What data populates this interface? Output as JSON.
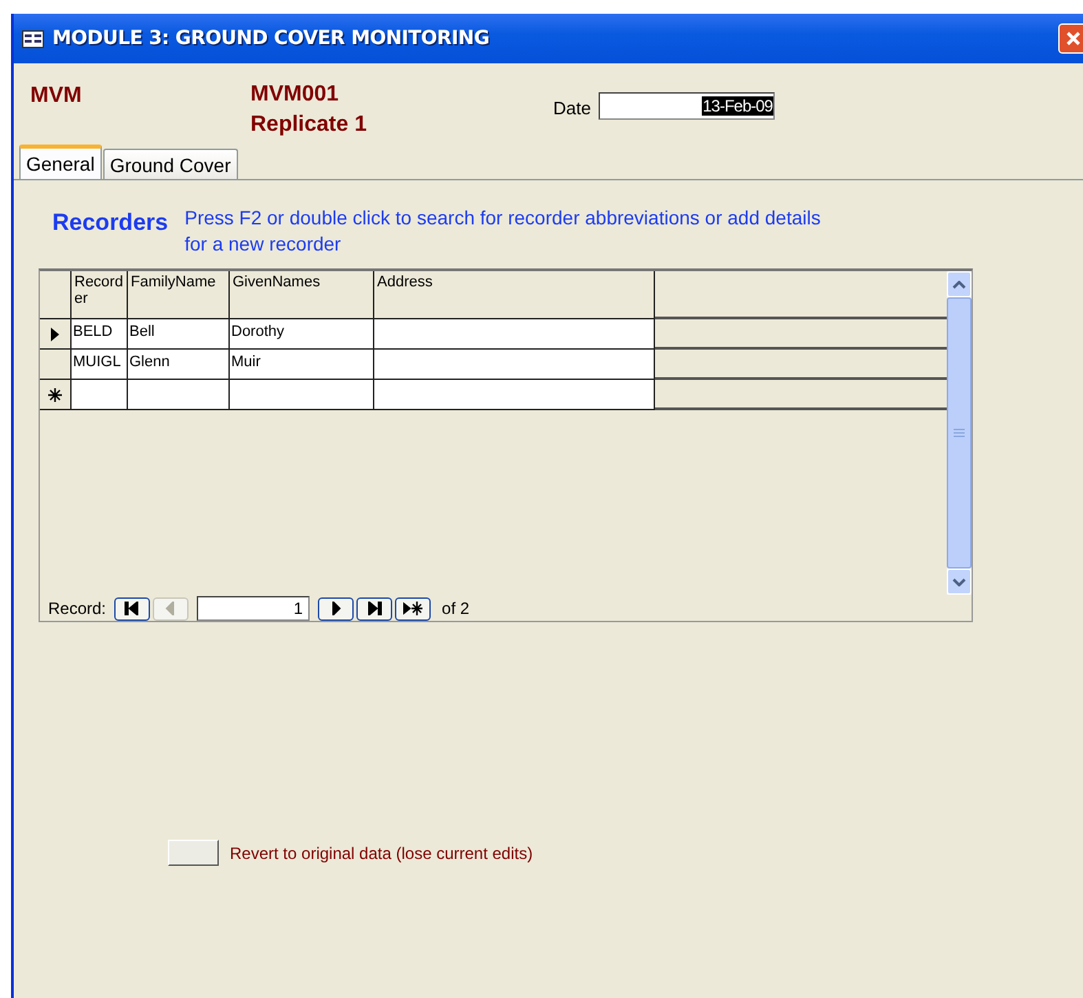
{
  "window": {
    "title": "MODULE 3: GROUND COVER MONITORING"
  },
  "header": {
    "site": "MVM",
    "plot": "MVM001",
    "replicate": "Replicate 1",
    "date_label": "Date",
    "date_value": "13-Feb-09"
  },
  "tabs": [
    {
      "label": "General",
      "selected": true
    },
    {
      "label": "Ground Cover",
      "selected": false
    }
  ],
  "recorders": {
    "title": "Recorders",
    "hint": "Press F2 or double click to search for recorder abbreviations or add details for a new recorder"
  },
  "table": {
    "columns": [
      "Recorder",
      "FamilyName",
      "GivenNames",
      "Address"
    ],
    "rows": [
      {
        "kind": "current",
        "cells": [
          "BELD",
          "Bell",
          "Dorothy",
          ""
        ]
      },
      {
        "kind": "record",
        "cells": [
          "MUIGL",
          "Glenn",
          "Muir",
          ""
        ]
      },
      {
        "kind": "new",
        "cells": [
          "",
          "",
          "",
          ""
        ]
      }
    ]
  },
  "navigation": {
    "label": "Record:",
    "buttons": [
      {
        "kind": "first",
        "disabled": false
      },
      {
        "kind": "prev",
        "disabled": true
      },
      {
        "kind": "next",
        "disabled": false
      },
      {
        "kind": "last",
        "disabled": false
      },
      {
        "kind": "new",
        "disabled": false
      }
    ],
    "current": "1",
    "total": "of 2"
  },
  "revert": {
    "label": "Revert to original data (lose current edits)"
  }
}
